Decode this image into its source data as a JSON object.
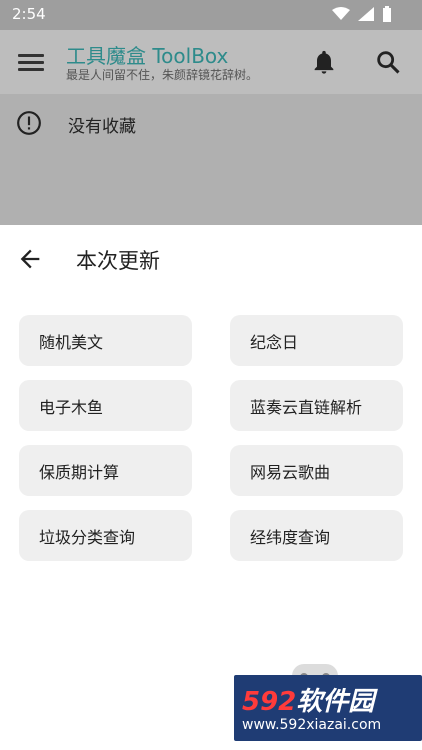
{
  "status_bar": {
    "time": "2:54"
  },
  "app_bar": {
    "title": "工具魔盒 ToolBox",
    "subtitle": "最是人间留不住，朱颜辞镜花辞树。"
  },
  "content": {
    "empty_message": "没有收藏"
  },
  "sheet": {
    "title": "本次更新",
    "items": [
      "随机美文",
      "纪念日",
      "电子木鱼",
      "蓝奏云直链解析",
      "保质期计算",
      "网易云歌曲",
      "垃圾分类查询",
      "经纬度查询"
    ]
  },
  "watermark": {
    "brand_a": "592",
    "brand_b": "软件园",
    "url": "www.592xiazai.com"
  },
  "colors": {
    "accent": "#2e8b8b",
    "chip_bg": "#efefef",
    "overlay": "#b0b0b0"
  }
}
